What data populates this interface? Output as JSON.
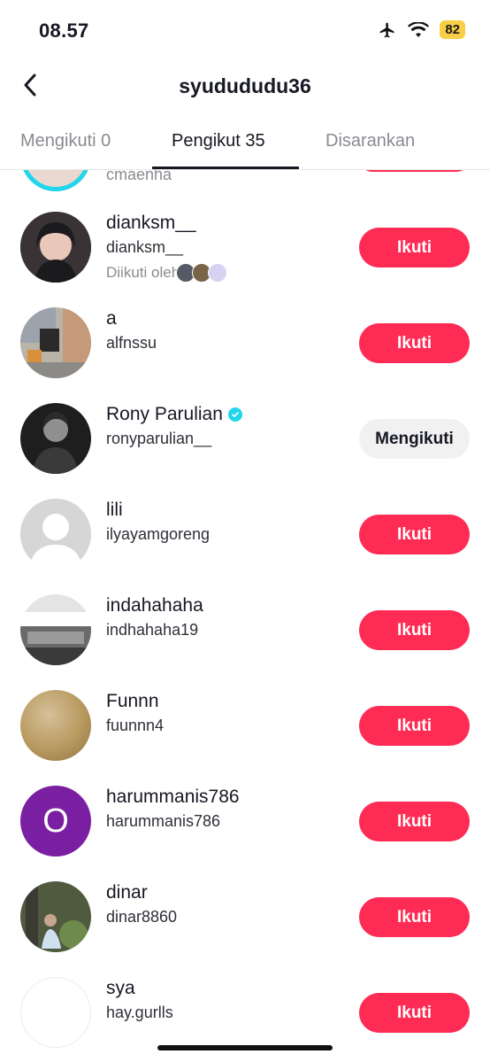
{
  "status_bar": {
    "time": "08.57",
    "battery": "82"
  },
  "header": {
    "title": "syudududu36",
    "back_icon": "chevron-left-icon"
  },
  "tabs": [
    {
      "label": "Mengikuti 0",
      "active": false
    },
    {
      "label": "Pengikut 35",
      "active": true
    },
    {
      "label": "Disarankan",
      "active": false
    }
  ],
  "partial_row": {
    "handle": "cmaenha"
  },
  "rows": [
    {
      "name": "dianksm__",
      "handle": "dianksm__",
      "mutual": "Diikuti oleh",
      "button": "Ikuti"
    },
    {
      "name": "a",
      "handle": "alfnssu",
      "button": "Ikuti"
    },
    {
      "name": "Rony Parulian",
      "handle": "ronyparulian__",
      "verified": true,
      "button": "Mengikuti"
    },
    {
      "name": "lili",
      "handle": "ilyayamgoreng",
      "button": "Ikuti"
    },
    {
      "name": "indahahaha",
      "handle": "indhahaha19",
      "button": "Ikuti"
    },
    {
      "name": "Funnn",
      "handle": "fuunnn4",
      "button": "Ikuti"
    },
    {
      "name": "harummanis786",
      "handle": "harummanis786",
      "avatar_letter": "O",
      "button": "Ikuti"
    },
    {
      "name": "dinar",
      "handle": "dinar8860",
      "button": "Ikuti"
    },
    {
      "name": "sya",
      "handle": "hay.gurlls",
      "button": "Ikuti"
    }
  ],
  "colors": {
    "accent": "#fe2c55",
    "following_bg": "#f1f1f2",
    "verified": "#20d5ec",
    "avatar_purple": "#7b1fa2"
  }
}
